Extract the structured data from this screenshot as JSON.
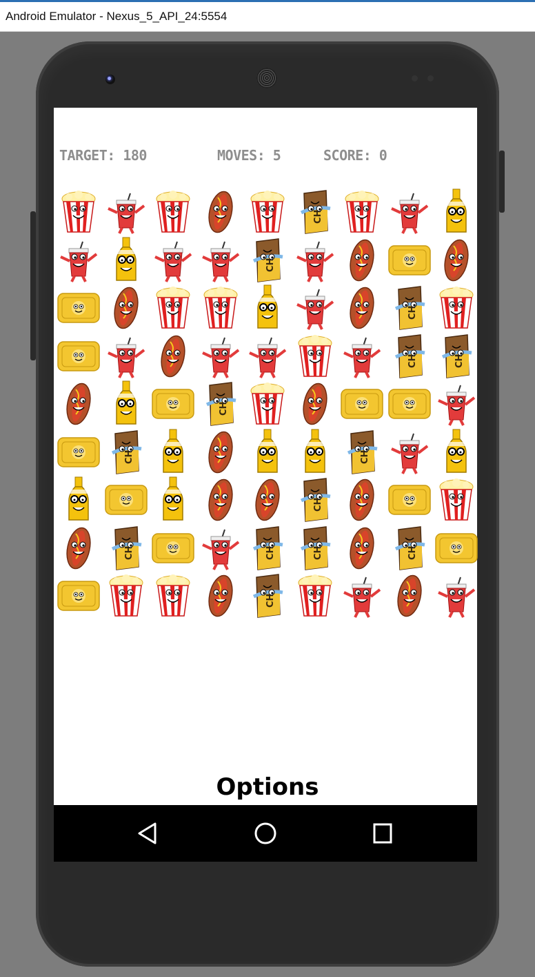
{
  "window": {
    "title": "Android Emulator - Nexus_5_API_24:5554"
  },
  "hud": {
    "target": "TARGET: 180",
    "moves": "MOVES: 5",
    "score": "SCORE: 0"
  },
  "board": {
    "rows": 9,
    "cols": 9,
    "tiles": [
      [
        "popcorn",
        "soda",
        "popcorn",
        "hotdog",
        "popcorn",
        "chocolate",
        "popcorn",
        "soda",
        "beer"
      ],
      [
        "soda",
        "beer",
        "soda",
        "soda",
        "chocolate",
        "soda",
        "hotdog",
        "ticket",
        "hotdog"
      ],
      [
        "ticket",
        "hotdog",
        "popcorn",
        "popcorn",
        "beer",
        "soda",
        "hotdog",
        "chocolate",
        "popcorn"
      ],
      [
        "ticket",
        "soda",
        "hotdog",
        "soda",
        "soda",
        "popcorn",
        "soda",
        "chocolate",
        "chocolate"
      ],
      [
        "hotdog",
        "beer",
        "ticket",
        "chocolate",
        "popcorn",
        "hotdog",
        "ticket",
        "ticket",
        "soda"
      ],
      [
        "ticket",
        "chocolate",
        "beer",
        "hotdog",
        "beer",
        "beer",
        "chocolate",
        "soda",
        "beer"
      ],
      [
        "beer",
        "ticket",
        "beer",
        "hotdog",
        "hotdog",
        "chocolate",
        "hotdog",
        "ticket",
        "popcorn"
      ],
      [
        "hotdog",
        "chocolate",
        "ticket",
        "soda",
        "chocolate",
        "chocolate",
        "hotdog",
        "chocolate",
        "ticket"
      ],
      [
        "ticket",
        "popcorn",
        "popcorn",
        "hotdog",
        "chocolate",
        "popcorn",
        "soda",
        "hotdog",
        "soda"
      ]
    ]
  },
  "options_label": "Options",
  "navbar": {
    "back_icon": "back-triangle-icon",
    "home_icon": "home-circle-icon",
    "recents_icon": "recents-square-icon"
  },
  "colors": {
    "hud_text": "#8e8e8e",
    "phone_body": "#2a2a2a",
    "navbar": "#000000",
    "popcorn_red": "#e02020",
    "ticket_yellow": "#f3c630",
    "soda_red": "#e23b3b",
    "beer_yellow": "#f4c20d",
    "hotdog_bun": "#b5512a",
    "chocolate_brown": "#8b5a2b"
  }
}
